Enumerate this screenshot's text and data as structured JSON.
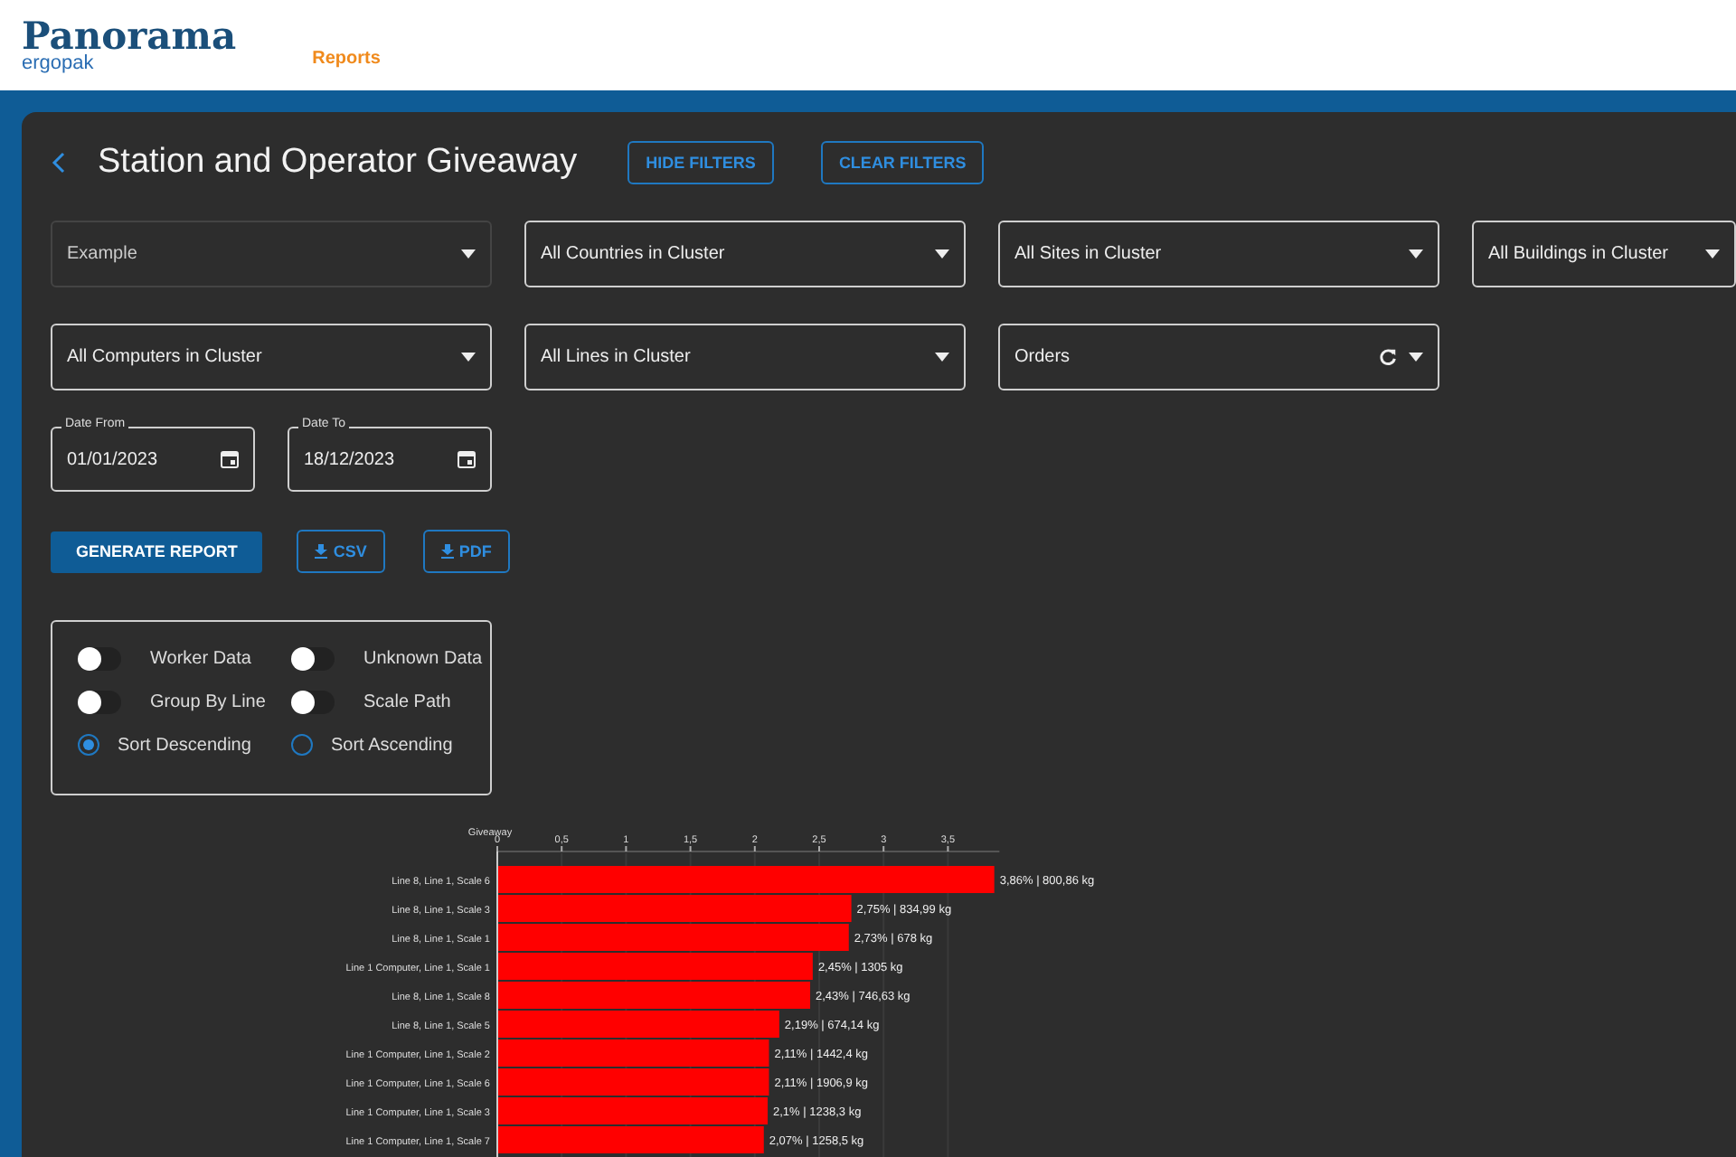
{
  "header": {
    "logo": "Panorama",
    "logo_sub": "ergopak",
    "nav": [
      {
        "label": "Reports",
        "selected": true
      }
    ]
  },
  "page": {
    "title": "Station and Operator Giveaway",
    "actions": [
      "HIDE FILTERS",
      "CLEAR FILTERS"
    ]
  },
  "filters": [
    {
      "kind": "select",
      "value": "Example",
      "disabled": true
    },
    {
      "kind": "select",
      "value": "All Countries in Cluster",
      "disabled": false
    },
    {
      "kind": "select",
      "value": "All Sites in Cluster",
      "disabled": false
    },
    {
      "kind": "select",
      "value": "All Buildings in Cluster",
      "disabled": false
    },
    {
      "kind": "select",
      "value": "All Computers in Cluster",
      "disabled": false
    },
    {
      "kind": "select",
      "value": "All Lines in Cluster",
      "disabled": false
    },
    {
      "kind": "select_refresh",
      "value": "Orders",
      "disabled": false
    }
  ],
  "dates": [
    {
      "label": "Date From",
      "value": "01/01/2023"
    },
    {
      "label": "Date To",
      "value": "18/12/2023"
    }
  ],
  "buttons": [
    {
      "kind": "primary",
      "label": "GENERATE REPORT"
    },
    {
      "kind": "download",
      "label": "CSV"
    },
    {
      "kind": "download",
      "label": "PDF"
    }
  ],
  "options": [
    {
      "kind": "toggle",
      "label": "Worker Data",
      "on": false
    },
    {
      "kind": "toggle",
      "label": "Unknown Data",
      "on": false
    },
    {
      "kind": "toggle",
      "label": "Group By Line",
      "on": false
    },
    {
      "kind": "toggle",
      "label": "Scale Path",
      "on": false
    },
    {
      "kind": "radio",
      "label": "Sort Descending",
      "selected": true
    },
    {
      "kind": "radio",
      "label": "Sort Ascending",
      "selected": false
    }
  ],
  "chart_data": {
    "type": "bar",
    "orientation": "horizontal",
    "xlabel": "Giveaway",
    "categories": [
      "Line 8, Line 1, Scale 6",
      "Line 8, Line 1, Scale 3",
      "Line 8, Line 1, Scale 1",
      "Line 1 Computer, Line 1, Scale 1",
      "Line 8, Line 1, Scale 8",
      "Line 8, Line 1, Scale 5",
      "Line 1 Computer, Line 1, Scale 2",
      "Line 1 Computer, Line 1, Scale 6",
      "Line 1 Computer, Line 1, Scale 3",
      "Line 1 Computer, Line 1, Scale 7"
    ],
    "series": [
      {
        "color": "#ff0000",
        "values": [
          3.86,
          2.75,
          2.73,
          2.45,
          2.43,
          2.19,
          2.11,
          2.11,
          2.1,
          2.07
        ]
      }
    ],
    "grid": true,
    "xlim": [
      0,
      3.9
    ],
    "xticks": [
      {
        "value": 0,
        "label": "0"
      },
      {
        "value": 0.5,
        "label": "0,5"
      },
      {
        "value": 1,
        "label": "1"
      },
      {
        "value": 1.5,
        "label": "1,5"
      },
      {
        "value": 2,
        "label": "2"
      },
      {
        "value": 2.5,
        "label": "2,5"
      },
      {
        "value": 3,
        "label": "3"
      },
      {
        "value": 3.5,
        "label": "3,5"
      }
    ],
    "value_labels": [
      "3,86% | 800,86 kg",
      "2,75% | 834,99 kg",
      "2,73% | 678 kg",
      "2,45% | 1305 kg",
      "2,43% | 746,63 kg",
      "2,19% | 674,14 kg",
      "2,11% | 1442,4 kg",
      "2,11% | 1906,9 kg",
      "2,1% | 1238,3 kg",
      "2,07% | 1258,5 kg"
    ]
  }
}
